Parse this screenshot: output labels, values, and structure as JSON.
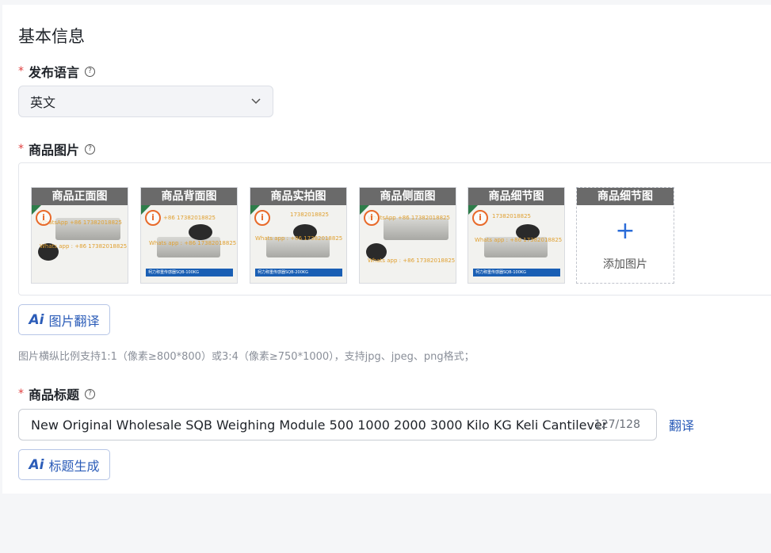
{
  "section": {
    "title": "基本信息"
  },
  "language": {
    "required_mark": "*",
    "label": "发布语言",
    "help_icon": "question-circle-icon",
    "selected": "英文"
  },
  "images": {
    "required_mark": "*",
    "label": "商品图片",
    "help_icon": "question-circle-icon",
    "thumbnails": [
      {
        "caption": "商品正面图"
      },
      {
        "caption": "商品背面图"
      },
      {
        "caption": "商品实拍图"
      },
      {
        "caption": "商品侧面图"
      },
      {
        "caption": "商品细节图"
      }
    ],
    "add_slot": {
      "caption": "商品细节图",
      "label": "添加图片"
    },
    "translate_button": {
      "ai": "Ai",
      "label": "图片翻译"
    },
    "hint": "图片横纵比例支持1:1（像素≥800*800）或3:4（像素≥750*1000），支持jpg、jpeg、png格式；"
  },
  "product_title": {
    "required_mark": "*",
    "label": "商品标题",
    "help_icon": "question-circle-icon",
    "value": "New Original Wholesale SQB Weighing Module 500 1000 2000 3000 Kilo KG Keli Cantilever",
    "counter": "127/128",
    "translate_link": "翻译",
    "generate_button": {
      "ai": "Ai",
      "label": "标题生成"
    }
  },
  "colors": {
    "accent": "#2b5cb8",
    "required": "#e04040"
  }
}
